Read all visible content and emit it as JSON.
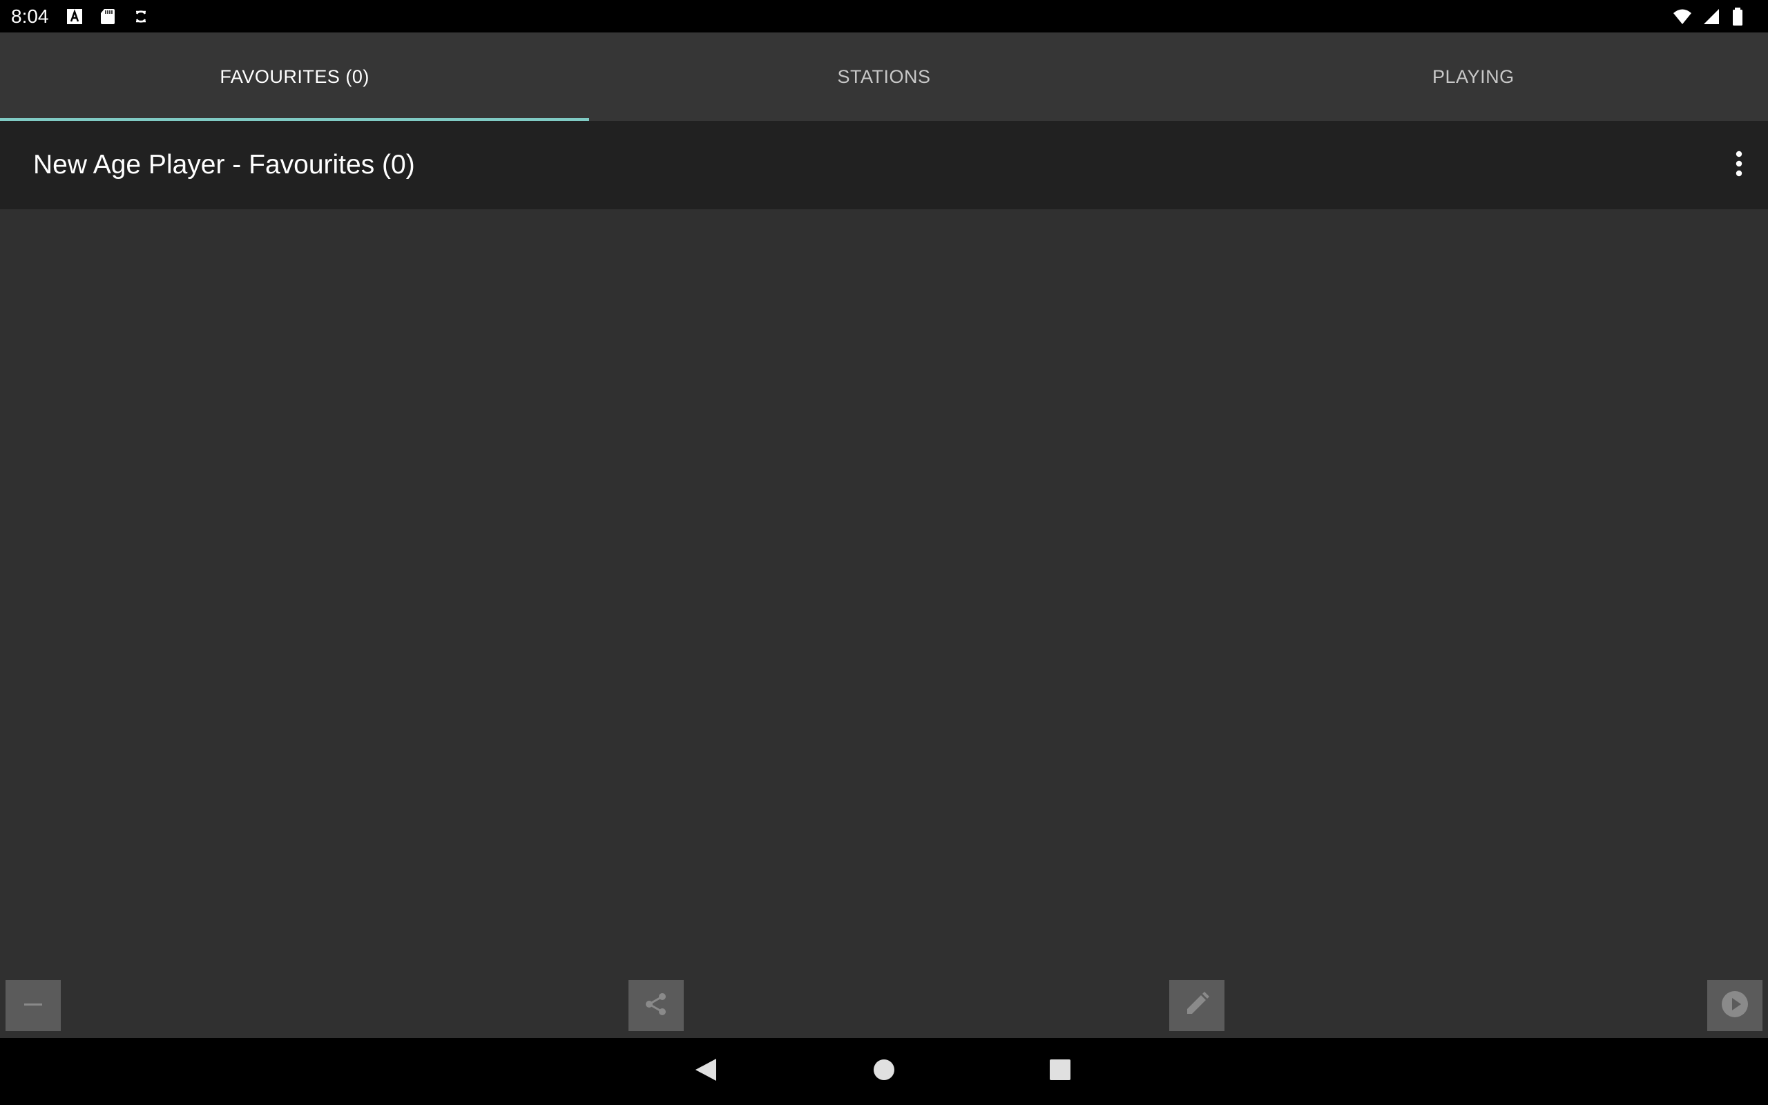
{
  "status_bar": {
    "time": "8:04",
    "left_icons": [
      "font-a-icon",
      "sd-card-icon",
      "sync-icon"
    ],
    "right_icons": [
      "wifi-icon",
      "cell-signal-icon",
      "battery-icon"
    ]
  },
  "tabs": [
    {
      "label": "FAVOURITES (0)",
      "active": true
    },
    {
      "label": "STATIONS",
      "active": false
    },
    {
      "label": "PLAYING",
      "active": false
    }
  ],
  "header": {
    "title": "New Age Player - Favourites (0)",
    "menu_icon": "more-vert-icon"
  },
  "action_bar": {
    "buttons": [
      "remove-icon",
      "share-icon",
      "edit-icon",
      "play-icon"
    ]
  },
  "nav_bar": {
    "buttons": [
      "back-icon",
      "home-icon",
      "recents-icon"
    ]
  },
  "colors": {
    "accent": "#80cbc4",
    "tab_bar_bg": "#363636",
    "header_bg": "#212121",
    "content_bg": "#303030",
    "action_button_bg": "#5b5b5b"
  }
}
